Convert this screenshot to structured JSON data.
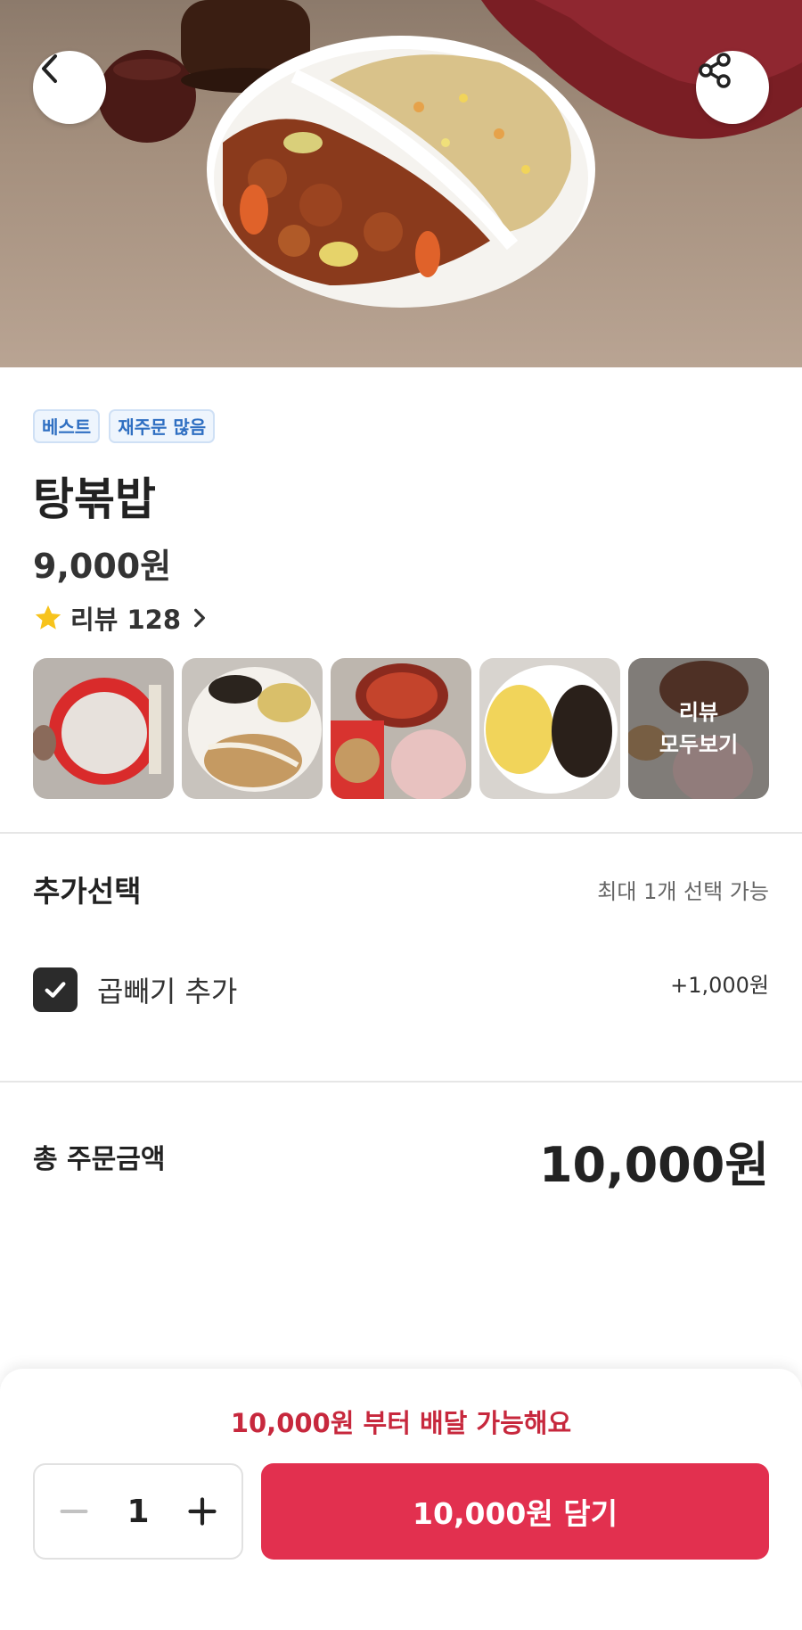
{
  "hero": {
    "back_icon": "chevron-left-icon",
    "share_icon": "share-icon"
  },
  "product": {
    "badges": [
      "베스트",
      "재주문 많음"
    ],
    "name": "탕볶밥",
    "price": "9,000원",
    "review_label": "리뷰 128",
    "rating_icon": "star-icon",
    "review_more": "리뷰\n모두보기",
    "review_more_line1": "리뷰",
    "review_more_line2": "모두보기"
  },
  "options": {
    "title": "추가선택",
    "hint": "최대 1개 선택 가능",
    "items": [
      {
        "label": "곱빼기 추가",
        "price": "+1,000원",
        "checked": true
      }
    ]
  },
  "total": {
    "label": "총 주문금액",
    "value": "10,000원"
  },
  "bottom": {
    "notice": "10,000원 부터 배달 가능해요",
    "quantity": "1",
    "add_button": "10,000원 담기"
  },
  "colors": {
    "accent": "#e2304f",
    "notice": "#c7283d",
    "badge_text": "#2f6fc2",
    "badge_bg": "#eef5fd",
    "star": "#f7c31c"
  }
}
